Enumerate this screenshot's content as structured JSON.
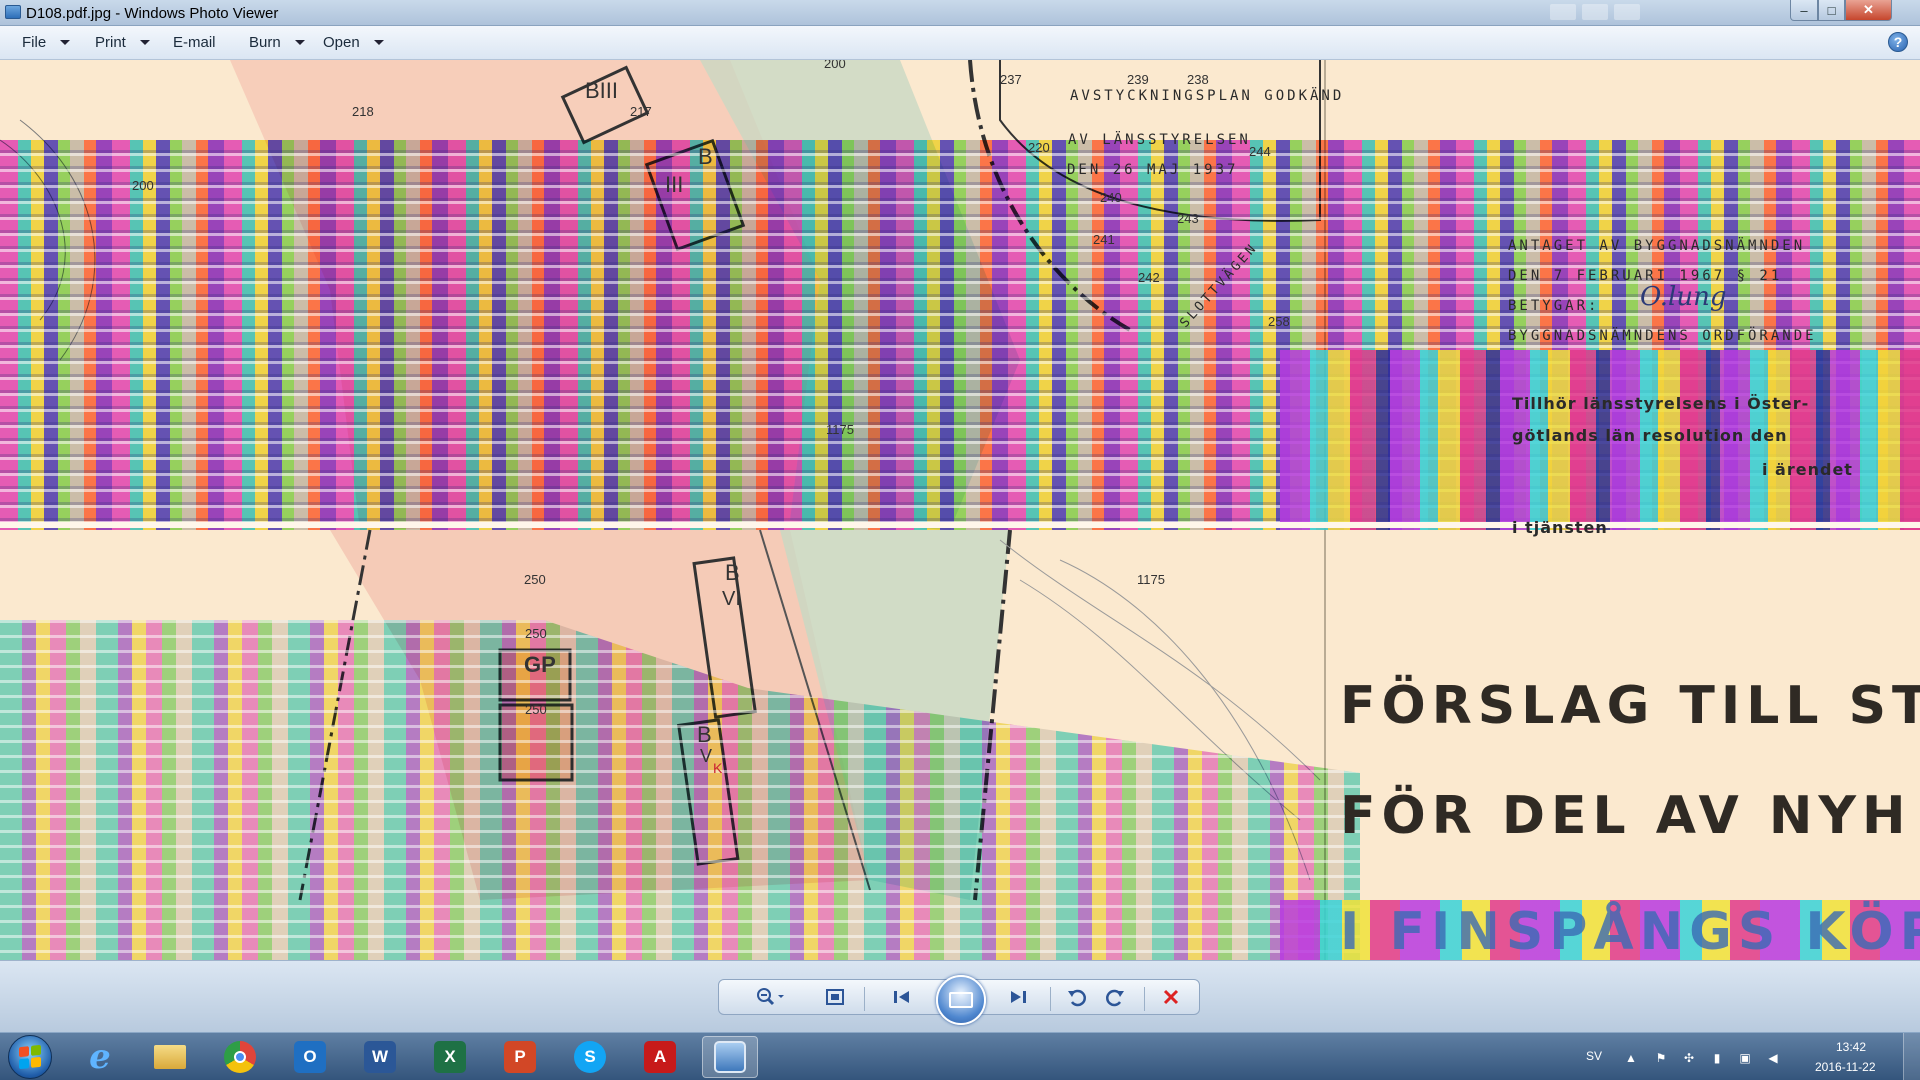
{
  "window": {
    "title": "D108.pdf.jpg - Windows Photo Viewer",
    "minimize": "–",
    "maximize": "□",
    "close": "✕"
  },
  "menu": {
    "items": [
      {
        "label": "File",
        "has_dropdown": true
      },
      {
        "label": "Print",
        "has_dropdown": true
      },
      {
        "label": "E-mail",
        "has_dropdown": false
      },
      {
        "label": "Burn",
        "has_dropdown": true
      },
      {
        "label": "Open",
        "has_dropdown": true
      }
    ],
    "help": "?"
  },
  "image": {
    "map_numbers": [
      "200",
      "218",
      "217",
      "237",
      "239",
      "238",
      "220",
      "244",
      "240",
      "243",
      "241",
      "242",
      "258",
      "1175",
      "1175",
      "200"
    ],
    "zone_labels": [
      "BIII",
      "B",
      "III",
      "B",
      "VI",
      "GP",
      "B",
      "V",
      "K"
    ],
    "plot_values": [
      "250",
      "250",
      "250"
    ],
    "approval_stamp": [
      "AVSTYCKNINGSPLAN GODKÄND",
      "AV LÄNSSTYRELSEN",
      "DEN 26 MAJ 1937"
    ],
    "road_name": "SLOTTVÄGEN",
    "council_text": [
      "ANTAGET AV BYGGNADSNÄMNDEN",
      "DEN 7 FEBRUARI 1967 § 21",
      "BETYGAR:",
      "BYGGNADSNÄMNDENS ORDFÖRANDE"
    ],
    "county_text": [
      "Tillhör länsstyrelsens i Öster-",
      "götlands län resolution den",
      "i ärendet",
      "i tjänsten"
    ],
    "signature": "O.lung",
    "title_lines": [
      "FÖRSLAG TILL ST",
      "FÖR DEL AV NYH",
      "I FINSPÅNGS KÖP"
    ]
  },
  "toolbar": {
    "zoom_icon": "magnifier-icon",
    "fit_icon": "fit-window-icon",
    "prev_icon": "previous-icon",
    "slideshow_icon": "slideshow-icon",
    "next_icon": "next-icon",
    "rotate_ccw_icon": "rotate-counterclockwise-icon",
    "rotate_cw_icon": "rotate-clockwise-icon",
    "delete_icon": "delete-icon"
  },
  "taskbar": {
    "pinned": [
      {
        "name": "internet-explorer",
        "glyph": "e",
        "color": "#2a8be0"
      },
      {
        "name": "file-explorer",
        "glyph": "",
        "color": "#e8c35a"
      },
      {
        "name": "chrome",
        "glyph": "",
        "color": "#e0453a"
      },
      {
        "name": "outlook",
        "glyph": "O",
        "color": "#1f6fc2"
      },
      {
        "name": "word",
        "glyph": "W",
        "color": "#2b5797"
      },
      {
        "name": "excel",
        "glyph": "X",
        "color": "#1e7145"
      },
      {
        "name": "powerpoint",
        "glyph": "P",
        "color": "#d24726"
      },
      {
        "name": "skype",
        "glyph": "S",
        "color": "#12a5f4"
      },
      {
        "name": "acrobat",
        "glyph": "A",
        "color": "#c71a1a"
      },
      {
        "name": "photo-viewer",
        "glyph": "",
        "color": "#5c8ec4"
      }
    ],
    "language": "SV",
    "time": "13:42",
    "date": "2016-11-22"
  }
}
